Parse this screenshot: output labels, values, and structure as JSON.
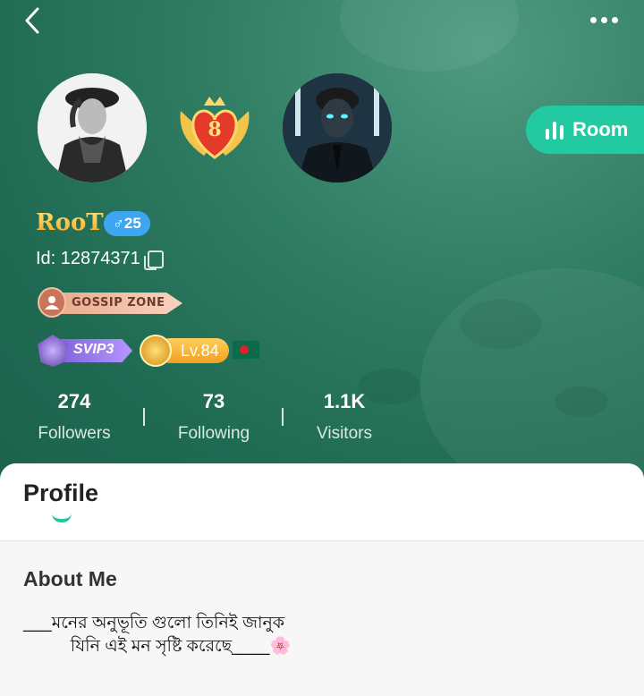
{
  "nav": {
    "back_icon": "chevron-left-icon",
    "more_icon": "more-dots-icon"
  },
  "room_button": {
    "label": "Room",
    "icon": "audio-bars-icon"
  },
  "user": {
    "name": "RooT",
    "gender_badge": "♂25",
    "id_text": "Id: 12874371",
    "level_badge": "8",
    "family_badge": "GOSSIP ZONE",
    "vip_badge": "SVIP3",
    "level": "Lv.84",
    "country_flag": "bangladesh-flag-icon"
  },
  "stats": [
    {
      "value": "274",
      "label": "Followers"
    },
    {
      "value": "73",
      "label": "Following"
    },
    {
      "value": "1.1K",
      "label": "Visitors"
    }
  ],
  "tabs": {
    "active": "Profile"
  },
  "about": {
    "title": "About Me",
    "text": "___মনের অনুভূতি গুলো তিনিই জানুক\n          যিনি এই মন সৃষ্টি করেছে____🌸"
  },
  "colors": {
    "accent": "#22c9a1",
    "header_bg": "#2f7d63",
    "gender_badge": "#3ea6f0"
  }
}
